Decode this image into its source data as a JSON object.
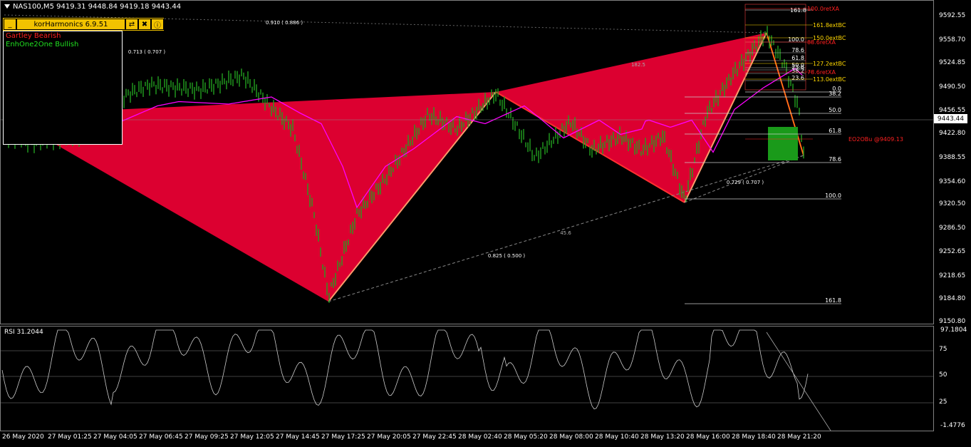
{
  "window": {
    "title": "NAS100,M5  9419.31 9448.84 9419.18 9443.44",
    "current_price": "9443.44"
  },
  "indicator_panel": {
    "name": "korHarmonics 6.9.51",
    "minimize_label": "_",
    "icons": [
      "arrows-icon",
      "tools-icon",
      "info-icon"
    ],
    "patterns": [
      {
        "name": "Gartley Bearish",
        "color": "#ff2020"
      },
      {
        "name": "EnhOne2One Bullish",
        "color": "#20e020"
      }
    ]
  },
  "price_axis": [
    "9592.55",
    "9558.70",
    "9524.85",
    "9490.50",
    "9456.55",
    "9422.80",
    "9388.55",
    "9354.60",
    "9320.50",
    "9286.50",
    "9252.65",
    "9218.65",
    "9184.80",
    "9150.80"
  ],
  "fib_right": [
    {
      "label": "161.8",
      "color": "#fff"
    },
    {
      "label": "100.0retXA",
      "color": "#ff2020"
    },
    {
      "label": "161.8extBC",
      "color": "#ffd700"
    },
    {
      "label": "150.0extBC",
      "color": "#ffd700"
    },
    {
      "label": "88.6retXA",
      "color": "#ff2020"
    },
    {
      "label": "127.2extBC",
      "color": "#ffd700"
    },
    {
      "label": "113.0extBC",
      "color": "#ffd700"
    },
    {
      "label": "78.6retXA",
      "color": "#ff2020"
    },
    {
      "label": "EO2OBu   @9409.13",
      "color": "#ff2020"
    }
  ],
  "fib_levels": [
    "100.0",
    "78.6",
    "61.8",
    "50.0",
    "38.2",
    "23.6",
    "0.0",
    "23.6",
    "38.2",
    "50.0",
    "61.8",
    "78.6",
    "100.0",
    "161.8",
    "6.6"
  ],
  "ratios": [
    "0.910 ( 0.886 )",
    "0.713 ( 0.707 )",
    "0.825 ( 0.500 )",
    "0.729 ( 0.707 )",
    "182.5",
    "45.6"
  ],
  "rsi": {
    "label": "RSI 31.2044",
    "axis": [
      "97.1804",
      "75",
      "50",
      "25",
      "-1.4776"
    ]
  },
  "time_axis": [
    "26 May 2020",
    "27 May 01:25",
    "27 May 04:05",
    "27 May 06:45",
    "27 May 09:25",
    "27 May 12:05",
    "27 May 14:45",
    "27 May 17:25",
    "27 May 20:05",
    "27 May 22:45",
    "28 May 02:40",
    "28 May 05:20",
    "28 May 08:00",
    "28 May 10:40",
    "28 May 13:20",
    "28 May 16:00",
    "28 May 18:40",
    "28 May 21:20"
  ],
  "colors": {
    "pattern_fill": "#dc0030",
    "candle": "#22a020",
    "ma": "#ff00ff",
    "leg": "#ff9a6a",
    "box": "#1a9a1a"
  }
}
